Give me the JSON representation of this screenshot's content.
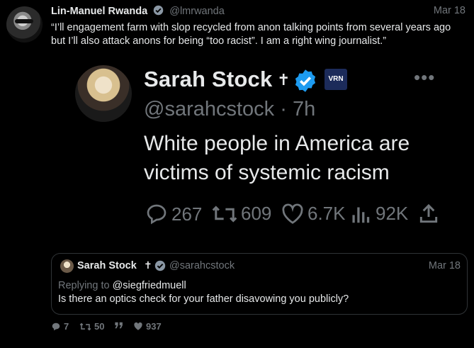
{
  "post": {
    "author_name": "Lin-Manuel Rwanda",
    "handle": "@lmrwanda",
    "date": "Mar 18",
    "text": "“I’ll engagement farm with slop recycled from anon talking points from several years ago but I’ll also attack anons for being “too racist”. I am a right wing journalist.”"
  },
  "screenshot": {
    "name": "Sarah Stock",
    "cross": "✝",
    "badge_text": "VRN",
    "menu": "•••",
    "handle_time": "@sarahcstock · 7h",
    "text": "White people in America are victims of systemic racism",
    "replies": "267",
    "reposts": "609",
    "likes": "6.7K",
    "views": "92K"
  },
  "quote": {
    "name": "Sarah Stock",
    "cross": "✝",
    "handle": "@sarahcstock",
    "date": "Mar 18",
    "replying_prefix": "Replying to ",
    "replying_to": "@siegfriedmuell",
    "text": "Is there an optics check for your father disavowing you publicly?"
  },
  "stats": {
    "replies": "7",
    "reposts": "50",
    "quotes": "",
    "likes": "937"
  },
  "colors": {
    "background": "#000000",
    "text": "#e7e9ea",
    "muted": "#71767b",
    "border": "#2f3336",
    "verified": "#1d9bf0"
  }
}
